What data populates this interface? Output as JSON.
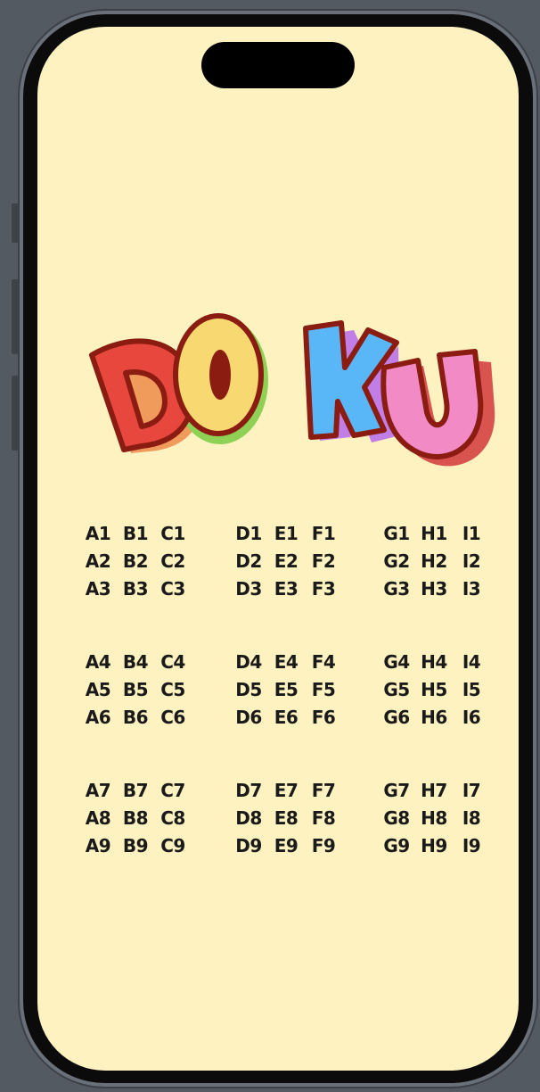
{
  "app": {
    "logo_text": "DOKU",
    "logo_letters": [
      {
        "char": "D",
        "fill": "#e8473e",
        "shadow": "#f09a5b"
      },
      {
        "char": "O",
        "fill": "#f8d870",
        "shadow": "#8ed154"
      },
      {
        "char": "K",
        "fill": "#5ab7f7",
        "shadow": "#c07ee6"
      },
      {
        "char": "U",
        "fill": "#f28ac6",
        "shadow": "#d9534f"
      }
    ],
    "outline_color": "#8a1c12",
    "background": "#fdf2c0"
  },
  "grid": {
    "blocks": [
      [
        [
          "A1",
          "B1",
          "C1"
        ],
        [
          "A2",
          "B2",
          "C2"
        ],
        [
          "A3",
          "B3",
          "C3"
        ]
      ],
      [
        [
          "D1",
          "E1",
          "F1"
        ],
        [
          "D2",
          "E2",
          "F2"
        ],
        [
          "D3",
          "E3",
          "F3"
        ]
      ],
      [
        [
          "G1",
          "H1",
          "I1"
        ],
        [
          "G2",
          "H2",
          "I2"
        ],
        [
          "G3",
          "H3",
          "I3"
        ]
      ],
      [
        [
          "A4",
          "B4",
          "C4"
        ],
        [
          "A5",
          "B5",
          "C5"
        ],
        [
          "A6",
          "B6",
          "C6"
        ]
      ],
      [
        [
          "D4",
          "E4",
          "F4"
        ],
        [
          "D5",
          "E5",
          "F5"
        ],
        [
          "D6",
          "E6",
          "F6"
        ]
      ],
      [
        [
          "G4",
          "H4",
          "I4"
        ],
        [
          "G5",
          "H5",
          "I5"
        ],
        [
          "G6",
          "H6",
          "I6"
        ]
      ],
      [
        [
          "A7",
          "B7",
          "C7"
        ],
        [
          "A8",
          "B8",
          "C8"
        ],
        [
          "A9",
          "B9",
          "C9"
        ]
      ],
      [
        [
          "D7",
          "E7",
          "F7"
        ],
        [
          "D8",
          "E8",
          "F8"
        ],
        [
          "D9",
          "E9",
          "F9"
        ]
      ],
      [
        [
          "G7",
          "H7",
          "I7"
        ],
        [
          "G8",
          "H8",
          "I8"
        ],
        [
          "G9",
          "H9",
          "I9"
        ]
      ]
    ]
  }
}
